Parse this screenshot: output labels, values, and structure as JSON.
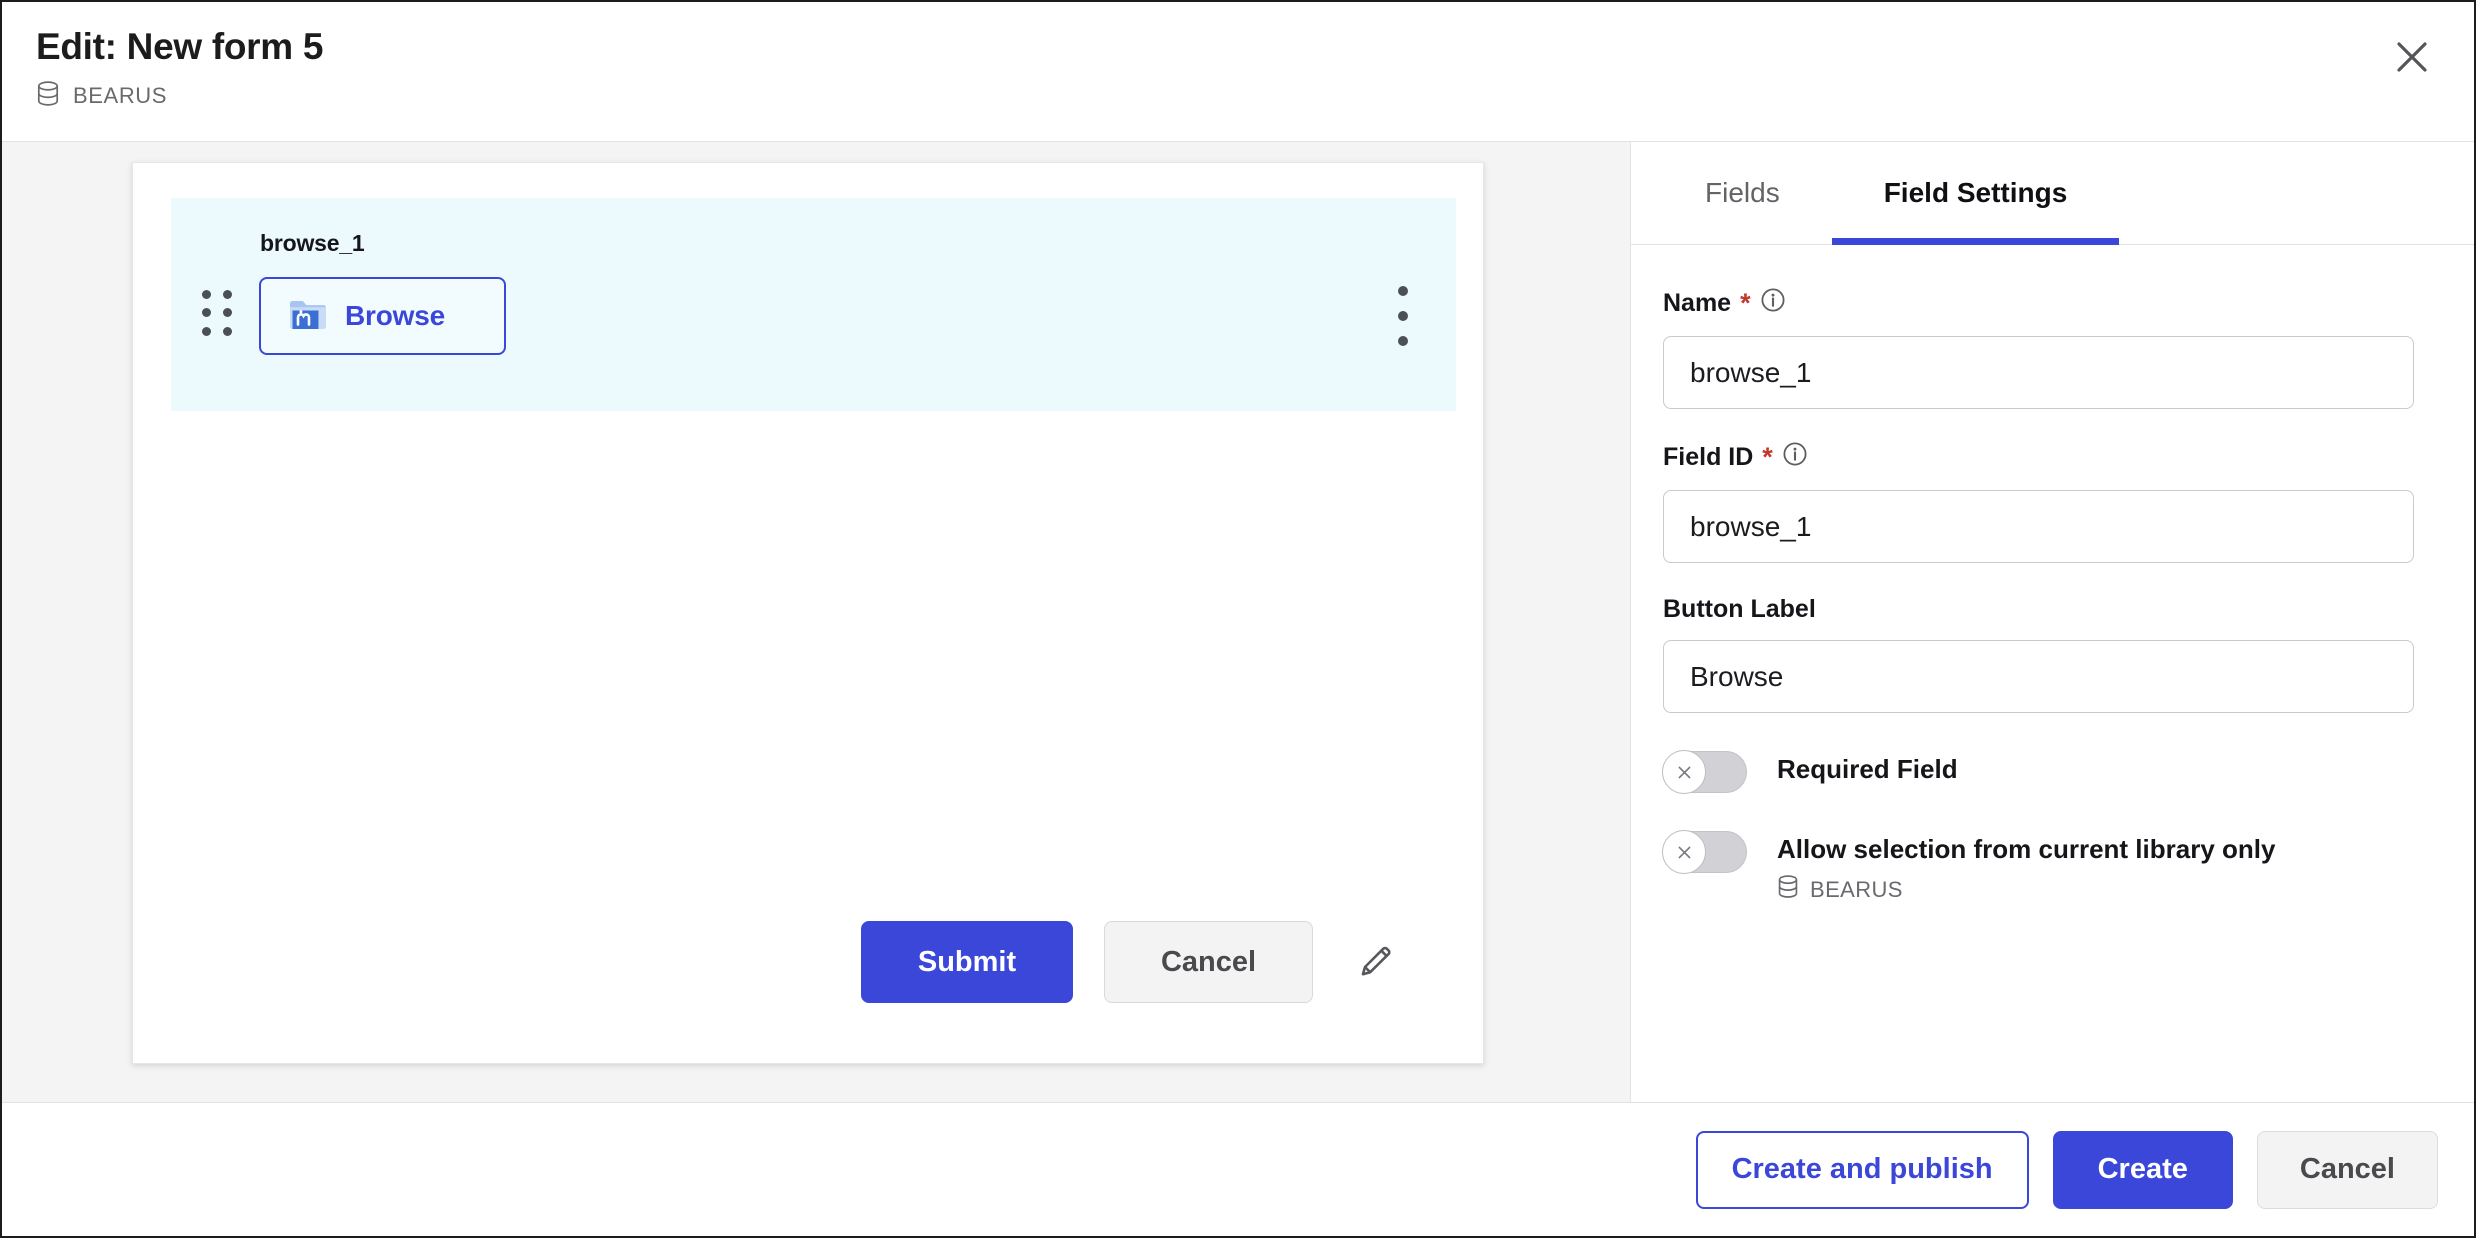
{
  "header": {
    "title": "Edit: New form 5",
    "library_name": "BEARUS",
    "library_icon": "database-icon",
    "close_icon": "close-icon"
  },
  "canvas": {
    "field": {
      "label": "browse_1",
      "drag_handle_icon": "drag-handle-icon",
      "menu_icon": "kebab-menu-icon",
      "button_label": "Browse",
      "button_icon": "folder-moodle-icon"
    },
    "actions": {
      "submit_label": "Submit",
      "cancel_label": "Cancel",
      "edit_icon": "pencil-icon"
    }
  },
  "panel": {
    "tabs": [
      {
        "label": "Fields",
        "active": false
      },
      {
        "label": "Field Settings",
        "active": true
      }
    ],
    "fields": [
      {
        "label": "Name",
        "required": true,
        "required_marker": "*",
        "info_icon": "info-icon",
        "value": "browse_1"
      },
      {
        "label": "Field ID",
        "required": true,
        "required_marker": "*",
        "info_icon": "info-icon",
        "value": "browse_1"
      },
      {
        "label": "Button Label",
        "required": false,
        "value": "Browse"
      }
    ],
    "toggles": [
      {
        "label": "Required Field",
        "state": "off",
        "knob_icon": "x-icon",
        "sub_label": null
      },
      {
        "label": "Allow selection from current library only",
        "state": "off",
        "knob_icon": "x-icon",
        "sub_label": "BEARUS",
        "sub_icon": "database-icon"
      }
    ]
  },
  "footer": {
    "create_and_publish_label": "Create and publish",
    "create_label": "Create",
    "cancel_label": "Cancel"
  },
  "colors": {
    "accent": "#3b47d9",
    "required": "#c0392b",
    "field_highlight": "#ecf9fd",
    "canvas_bg": "#f4f4f5"
  }
}
